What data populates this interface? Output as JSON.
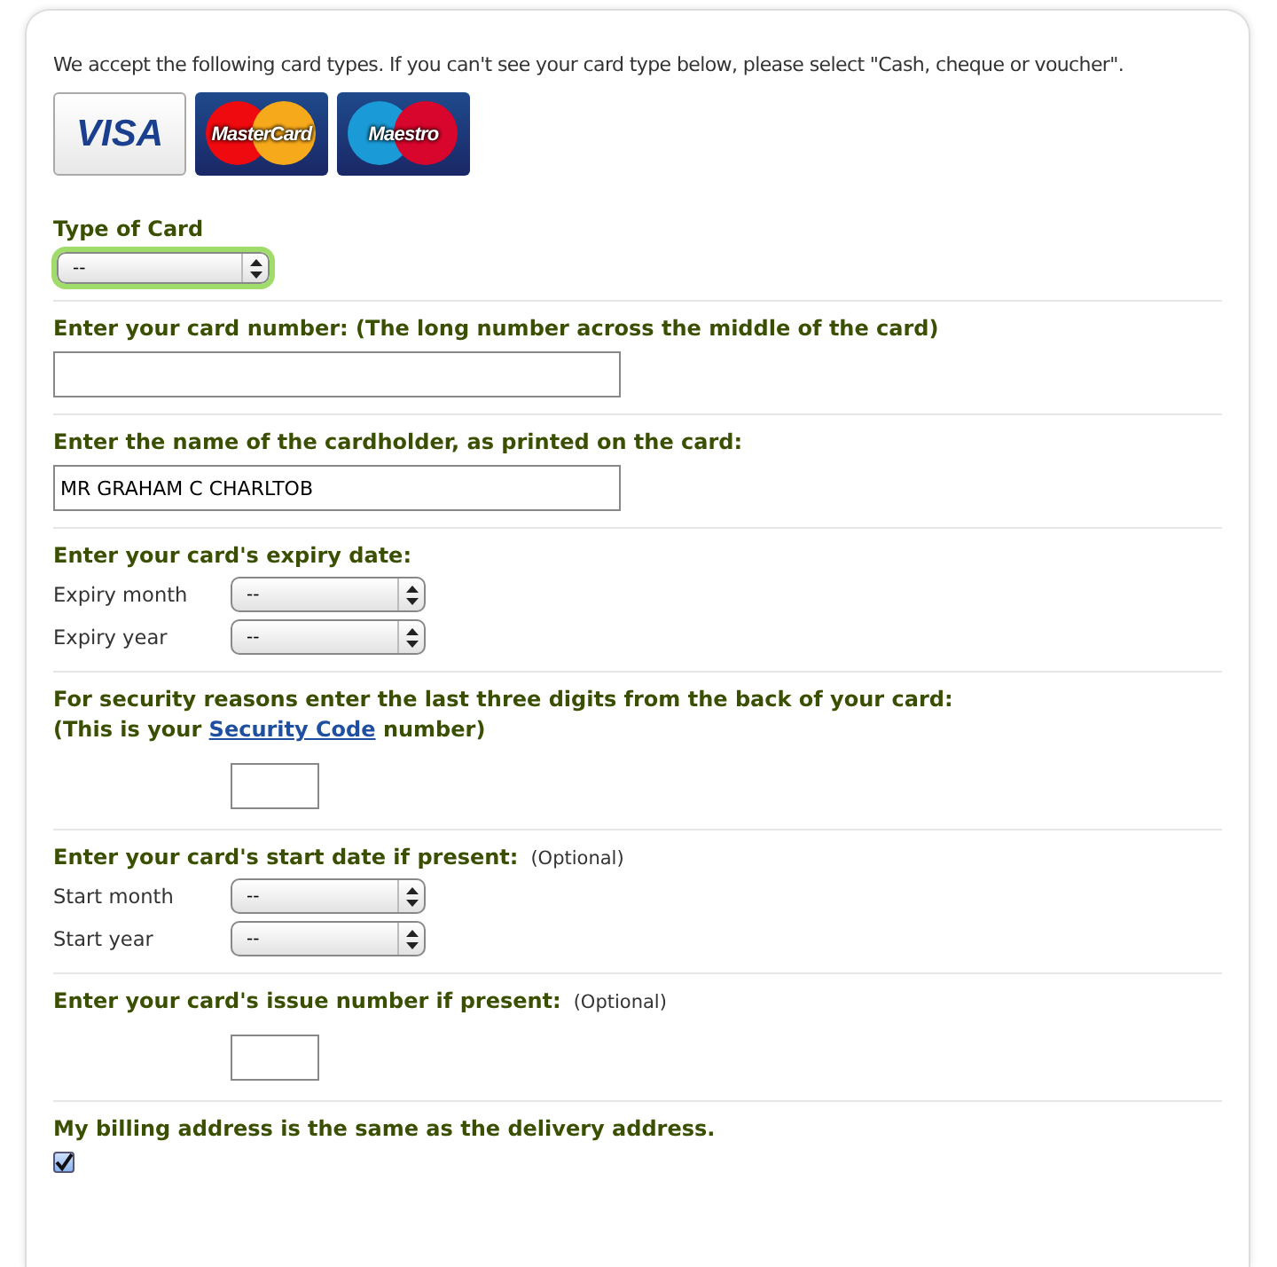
{
  "intro": "We accept the following card types. If you can't see your card type below, please select \"Cash, cheque or voucher\".",
  "cards": [
    {
      "kind": "visa",
      "label": "VISA"
    },
    {
      "kind": "mastercard",
      "label": "MasterCard"
    },
    {
      "kind": "maestro",
      "label": "Maestro"
    }
  ],
  "sections": [
    {
      "kind": "select",
      "label": "Type of Card",
      "value": "--",
      "highlighted": true
    },
    {
      "kind": "text",
      "label": "Enter your card number: (The long number across the middle of the card)"
    },
    {
      "kind": "text",
      "label": "Enter the name of the cardholder, as printed on the card:",
      "value": "MR GRAHAM C CHARLTOB"
    },
    {
      "kind": "dates",
      "label": "Enter your card's expiry date:",
      "rows": [
        {
          "label": "Expiry month",
          "value": "--"
        },
        {
          "label": "Expiry year",
          "value": "--"
        }
      ]
    },
    {
      "kind": "short",
      "label": "For security reasons enter the last three digits from the back of your card:",
      "note": {
        "before": "(This is your ",
        "link": "Security Code",
        "after": " number)"
      }
    },
    {
      "kind": "dates",
      "label": "Enter your card's start date if present:",
      "optional": "(Optional)",
      "rows": [
        {
          "label": "Start month",
          "value": "--"
        },
        {
          "label": "Start year",
          "value": "--"
        }
      ]
    },
    {
      "kind": "short",
      "label": "Enter your card's issue number if present:",
      "optional": "(Optional)"
    },
    {
      "kind": "checkbox",
      "label": "My billing address is the same as the delivery address.",
      "checked": true
    }
  ]
}
